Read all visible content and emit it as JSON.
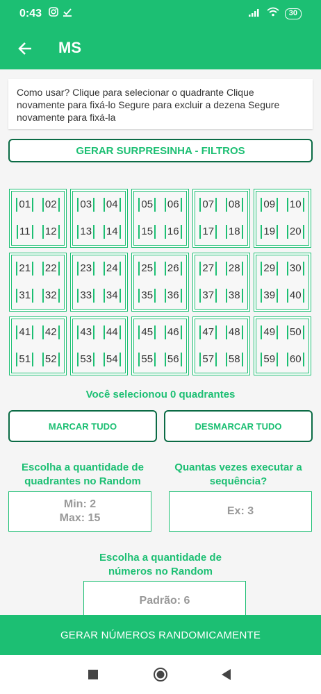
{
  "status": {
    "time": "0:43",
    "battery": "30",
    "notif_icons": [
      "instagram-icon",
      "download-icon"
    ]
  },
  "appbar": {
    "title": "MS"
  },
  "instructions": "Como usar? Clique para selecionar o quadrante Clique novamente para fixá-lo Segure para excluir a dezena Segure novamente para fixá-la",
  "surpresinha_label": "GERAR SURPRESINHA - FILTROS",
  "quadrants": [
    [
      "01",
      "02",
      "11",
      "12"
    ],
    [
      "03",
      "04",
      "13",
      "14"
    ],
    [
      "05",
      "06",
      "15",
      "16"
    ],
    [
      "07",
      "08",
      "17",
      "18"
    ],
    [
      "09",
      "10",
      "19",
      "20"
    ],
    [
      "21",
      "22",
      "31",
      "32"
    ],
    [
      "23",
      "24",
      "33",
      "34"
    ],
    [
      "25",
      "26",
      "35",
      "36"
    ],
    [
      "27",
      "28",
      "37",
      "38"
    ],
    [
      "29",
      "30",
      "39",
      "40"
    ],
    [
      "41",
      "42",
      "51",
      "52"
    ],
    [
      "43",
      "44",
      "53",
      "54"
    ],
    [
      "45",
      "46",
      "55",
      "56"
    ],
    [
      "47",
      "48",
      "57",
      "58"
    ],
    [
      "49",
      "50",
      "59",
      "60"
    ]
  ],
  "selected_text": "Você selecionou 0 quadrantes",
  "marcar_label": "MARCAR TUDO",
  "desmarcar_label": "DESMARCAR TUDO",
  "quads_label": "Escolha a quantidade de quadrantes no Random",
  "quads_min": "Min: 2",
  "quads_max": "Max: 15",
  "vezes_label": "Quantas vezes executar a sequência?",
  "vezes_placeholder": "Ex: 3",
  "nums_label": "Escolha a quantidade de números no Random",
  "nums_placeholder": "Padrão: 6",
  "gerar_label": "GERAR NÚMEROS RANDOMICAMENTE",
  "colors": {
    "primary": "#1cbf73",
    "dark_border": "#0b6b45"
  }
}
